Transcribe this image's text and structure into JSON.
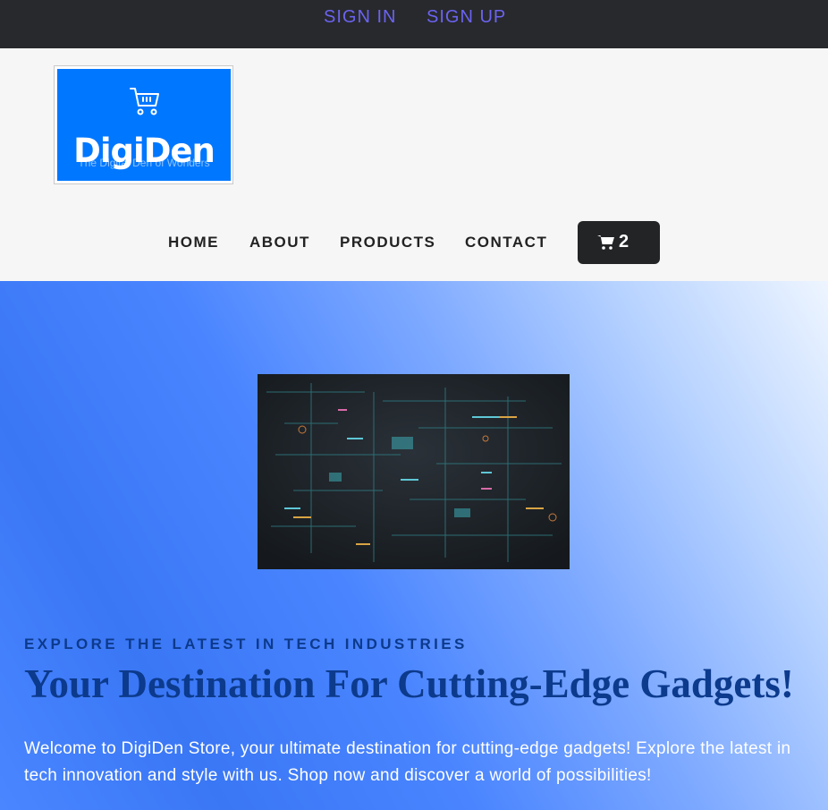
{
  "topbar": {
    "sign_in": "SIGN IN",
    "sign_up": "SIGN UP"
  },
  "logo": {
    "brand": "DigiDen",
    "tagline": "The Digital Den of Wonders",
    "icon": "shopping-cart-icon",
    "bg_color": "#0077ff"
  },
  "nav": {
    "items": [
      {
        "label": "HOME"
      },
      {
        "label": "ABOUT"
      },
      {
        "label": "PRODUCTS"
      },
      {
        "label": "CONTACT"
      }
    ],
    "cart": {
      "icon": "cart-icon",
      "count": "2"
    }
  },
  "hero": {
    "image": "circuit-board-image",
    "kicker": "EXPLORE THE LATEST IN TECH INDUSTRIES",
    "headline": "Your Destination For Cutting-Edge Gadgets!",
    "intro": "Welcome to DigiDen Store, your ultimate destination for cutting-edge gadgets! Explore the latest in tech innovation and style with us. Shop now and discover a world of possibilities!"
  },
  "colors": {
    "topbar_bg": "#28292d",
    "link_accent": "#6b63f0",
    "headline": "#0c3a8c",
    "cart_button": "#232426"
  }
}
